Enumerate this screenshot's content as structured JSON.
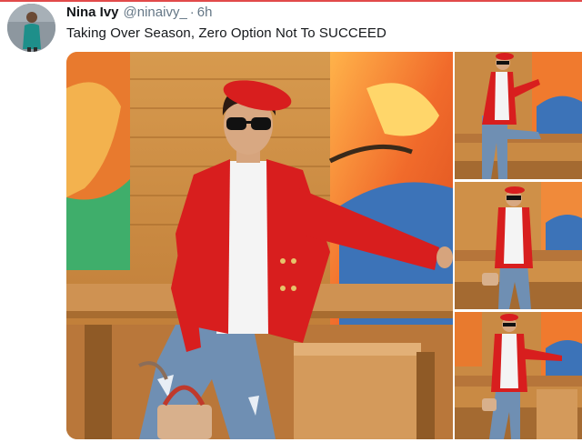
{
  "tweet": {
    "display_name": "Nina Ivy",
    "handle": "@ninaivy_",
    "separator": "·",
    "time": "6h",
    "text": "Taking Over Season, Zero Option Not To SUCCEED"
  },
  "media": {
    "photos": [
      {
        "icon": "main-photo"
      },
      {
        "icon": "thumbnail-photo"
      },
      {
        "icon": "thumbnail-photo"
      },
      {
        "icon": "thumbnail-photo"
      }
    ]
  },
  "colors": {
    "accent_border": "#e24a4a",
    "name_text": "#14171a",
    "muted_text": "#657786",
    "jacket_red": "#d81e1e",
    "wood": "#c8853f",
    "denim": "#6f8fb3"
  }
}
